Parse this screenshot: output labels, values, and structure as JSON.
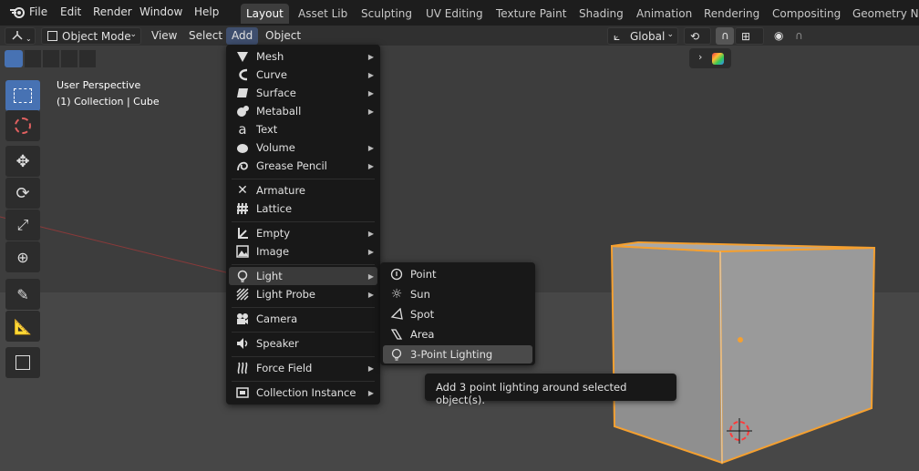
{
  "topbar": {
    "menus": [
      "File",
      "Edit",
      "Render",
      "Window",
      "Help"
    ],
    "workspaces": [
      "Layout",
      "Asset Lib",
      "Sculpting",
      "UV Editing",
      "Texture Paint",
      "Shading",
      "Animation",
      "Rendering",
      "Compositing",
      "Geometry Nod"
    ],
    "active_workspace": "Layout"
  },
  "header": {
    "mode": "Object Mode",
    "view": "View",
    "select": "Select",
    "add": "Add",
    "object": "Object",
    "orientation": "Global"
  },
  "viewport": {
    "perspective": "User Perspective",
    "collection": "(1) Collection | Cube"
  },
  "add_menu": {
    "items": [
      {
        "label": "Mesh",
        "icon": "mesh-icon",
        "submenu": true
      },
      {
        "label": "Curve",
        "icon": "curve-icon",
        "submenu": true
      },
      {
        "label": "Surface",
        "icon": "surface-icon",
        "submenu": true
      },
      {
        "label": "Metaball",
        "icon": "metaball-icon",
        "submenu": true
      },
      {
        "label": "Text",
        "icon": "text-icon",
        "submenu": false
      },
      {
        "label": "Volume",
        "icon": "volume-icon",
        "submenu": true
      },
      {
        "label": "Grease Pencil",
        "icon": "grease-pencil-icon",
        "submenu": true
      },
      {
        "label": "Armature",
        "icon": "armature-icon",
        "submenu": false
      },
      {
        "label": "Lattice",
        "icon": "lattice-icon",
        "submenu": false
      },
      {
        "label": "Empty",
        "icon": "empty-icon",
        "submenu": true
      },
      {
        "label": "Image",
        "icon": "image-icon",
        "submenu": true
      },
      {
        "label": "Light",
        "icon": "light-icon",
        "submenu": true
      },
      {
        "label": "Light Probe",
        "icon": "light-probe-icon",
        "submenu": true
      },
      {
        "label": "Camera",
        "icon": "camera-icon",
        "submenu": false
      },
      {
        "label": "Speaker",
        "icon": "speaker-icon",
        "submenu": false
      },
      {
        "label": "Force Field",
        "icon": "force-field-icon",
        "submenu": true
      },
      {
        "label": "Collection Instance",
        "icon": "collection-instance-icon",
        "submenu": true
      }
    ]
  },
  "light_menu": {
    "items": [
      {
        "label": "Point",
        "icon": "point-light-icon"
      },
      {
        "label": "Sun",
        "icon": "sun-light-icon"
      },
      {
        "label": "Spot",
        "icon": "spot-light-icon"
      },
      {
        "label": "Area",
        "icon": "area-light-icon"
      },
      {
        "label": "3-Point Lighting",
        "icon": "three-point-lighting-icon"
      }
    ]
  },
  "tooltip": {
    "text": "Add 3 point lighting around selected object(s)."
  },
  "colors": {
    "accent": "#4772b3",
    "selection_outline": "#f5a030",
    "menu_bg": "#181818"
  }
}
